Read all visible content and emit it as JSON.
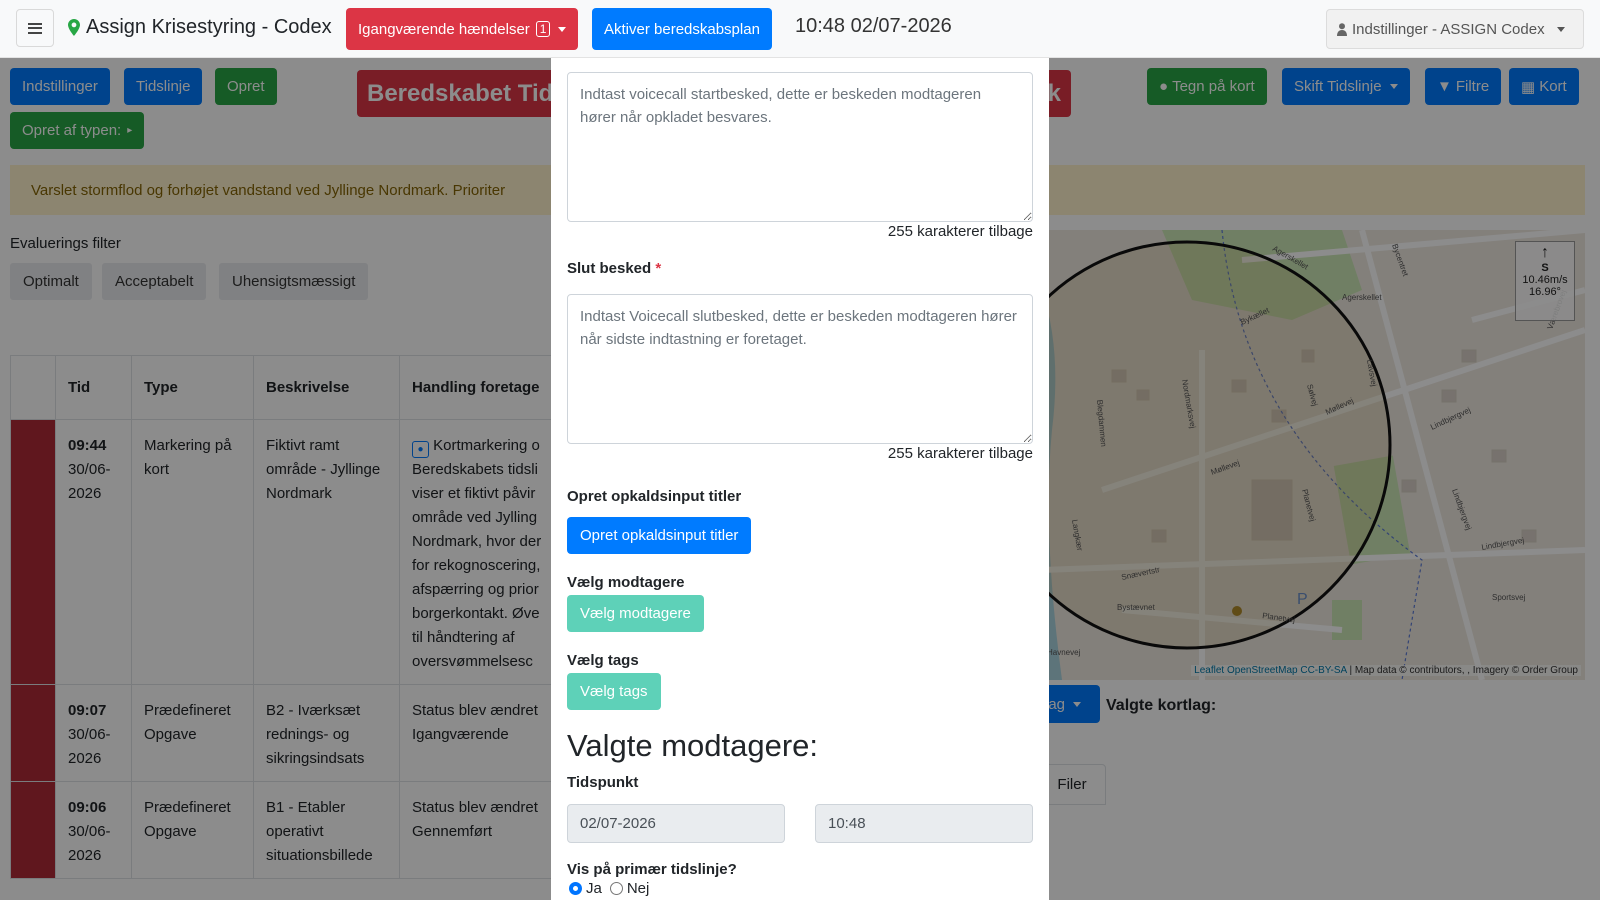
{
  "navbar": {
    "brand": "Assign Krisestyring - Codex",
    "ongoing_label": "Igangværende hændelser",
    "ongoing_count": "1",
    "activate_plan": "Aktiver beredskabsplan",
    "clock": "10:48 02/07-2026",
    "settings": "Indstillinger - ASSIGN Codex"
  },
  "toolbar": {
    "settings": "Indstillinger",
    "timeline": "Tidslinje",
    "create": "Opret",
    "create_by_type": "Opret af typen:",
    "title_partial_left": "Beredskabet Tid",
    "title_partial_right": "k",
    "draw_map": "Tegn på kort",
    "switch_timeline": "Skift Tidslinje",
    "filters": "Filtre",
    "map": "Kort"
  },
  "alert": {
    "text": "Varslet stormflod og forhøjet vandstand ved Jyllinge Nordmark. Prioriter"
  },
  "evaluation": {
    "label": "Evaluerings filter",
    "options": [
      "Optimalt",
      "Acceptabelt",
      "Uhensigtsmæssigt"
    ]
  },
  "table": {
    "headers": [
      "Tid",
      "Type",
      "Beskrivelse",
      "Handling foretage"
    ],
    "rows": [
      {
        "time": "09:44",
        "date": "30/06-2026",
        "type": "Markering på kort",
        "description": "Fiktivt ramt område - Jyllinge Nordmark",
        "action": "Kortmarkering o Beredskabets tidsli viser et fiktivt påvir område ved Jylling Nordmark, hvor der for rekognoscering, afspærring og prior borgerkontakt. Øve til håndtering af oversvømmelsesc"
      },
      {
        "time": "09:07",
        "date": "30/06-2026",
        "type": "Prædefineret Opgave",
        "description": "B2 - Iværksæt rednings- og sikringsindsats",
        "action": "Status blev ændret Igangværende"
      },
      {
        "time": "09:06",
        "date": "30/06-2026",
        "type": "Prædefineret Opgave",
        "description": "B1 - Etabler operativt situationsbillede",
        "action": "Status blev ændret Gennemført"
      }
    ]
  },
  "map": {
    "streets": [
      "Agerskellet",
      "Agerskellet",
      "Bykællet",
      "Nordmarksvej",
      "Møllevej",
      "Møllevej",
      "Lindbjergvej",
      "Lindbjergvej",
      "Lindbjergvej",
      "Planetvej",
      "Planetvej",
      "Snævertstr",
      "Bystævnet",
      "Langkær",
      "Blegdammen",
      "Sportsvej",
      "Havnevej",
      "Lavsvej",
      "Sølvej",
      "Værebrovej",
      "Bycentret"
    ],
    "attribution_links": "Leaflet OpenStreetMap CC-BY-SA",
    "attribution_text": "| Map data © contributors, , Imagery © Order Group",
    "wind_dir": "S",
    "wind_speed": "10.46m/s",
    "wind_deg": "16.96°",
    "layer_btn": "lag",
    "selected_layers": "Valgte kortlag:",
    "files_tab": "Filer"
  },
  "modal": {
    "start_placeholder": "Indtast voicecall startbesked, dette er beskeden modtageren hører når opkladet besvares.",
    "start_chars_left": "255 karakterer tilbage",
    "end_label": "Slut besked",
    "end_required": "*",
    "end_placeholder": "Indtast Voicecall slutbesked, dette er beskeden modtageren hører når sidste indtastning er foretaget.",
    "end_chars_left": "255 karakterer tilbage",
    "input_titles_label": "Opret opkaldsinput titler",
    "input_titles_btn": "Opret opkaldsinput titler",
    "recipients_label": "Vælg modtagere",
    "recipients_btn": "Vælg modtagere",
    "tags_label": "Vælg tags",
    "tags_btn": "Vælg tags",
    "selected_heading": "Valgte modtagere:",
    "time_label": "Tidspunkt",
    "date_value": "02/07-2026",
    "time_value": "10:48",
    "primary_label": "Vis på primær tidslinje?",
    "yes": "Ja",
    "no": "Nej"
  },
  "colors": {
    "primary": "#007bff",
    "danger": "#dc3545",
    "success": "#28a745",
    "teal": "#5ed1b8",
    "row_status": "#b02a37"
  }
}
